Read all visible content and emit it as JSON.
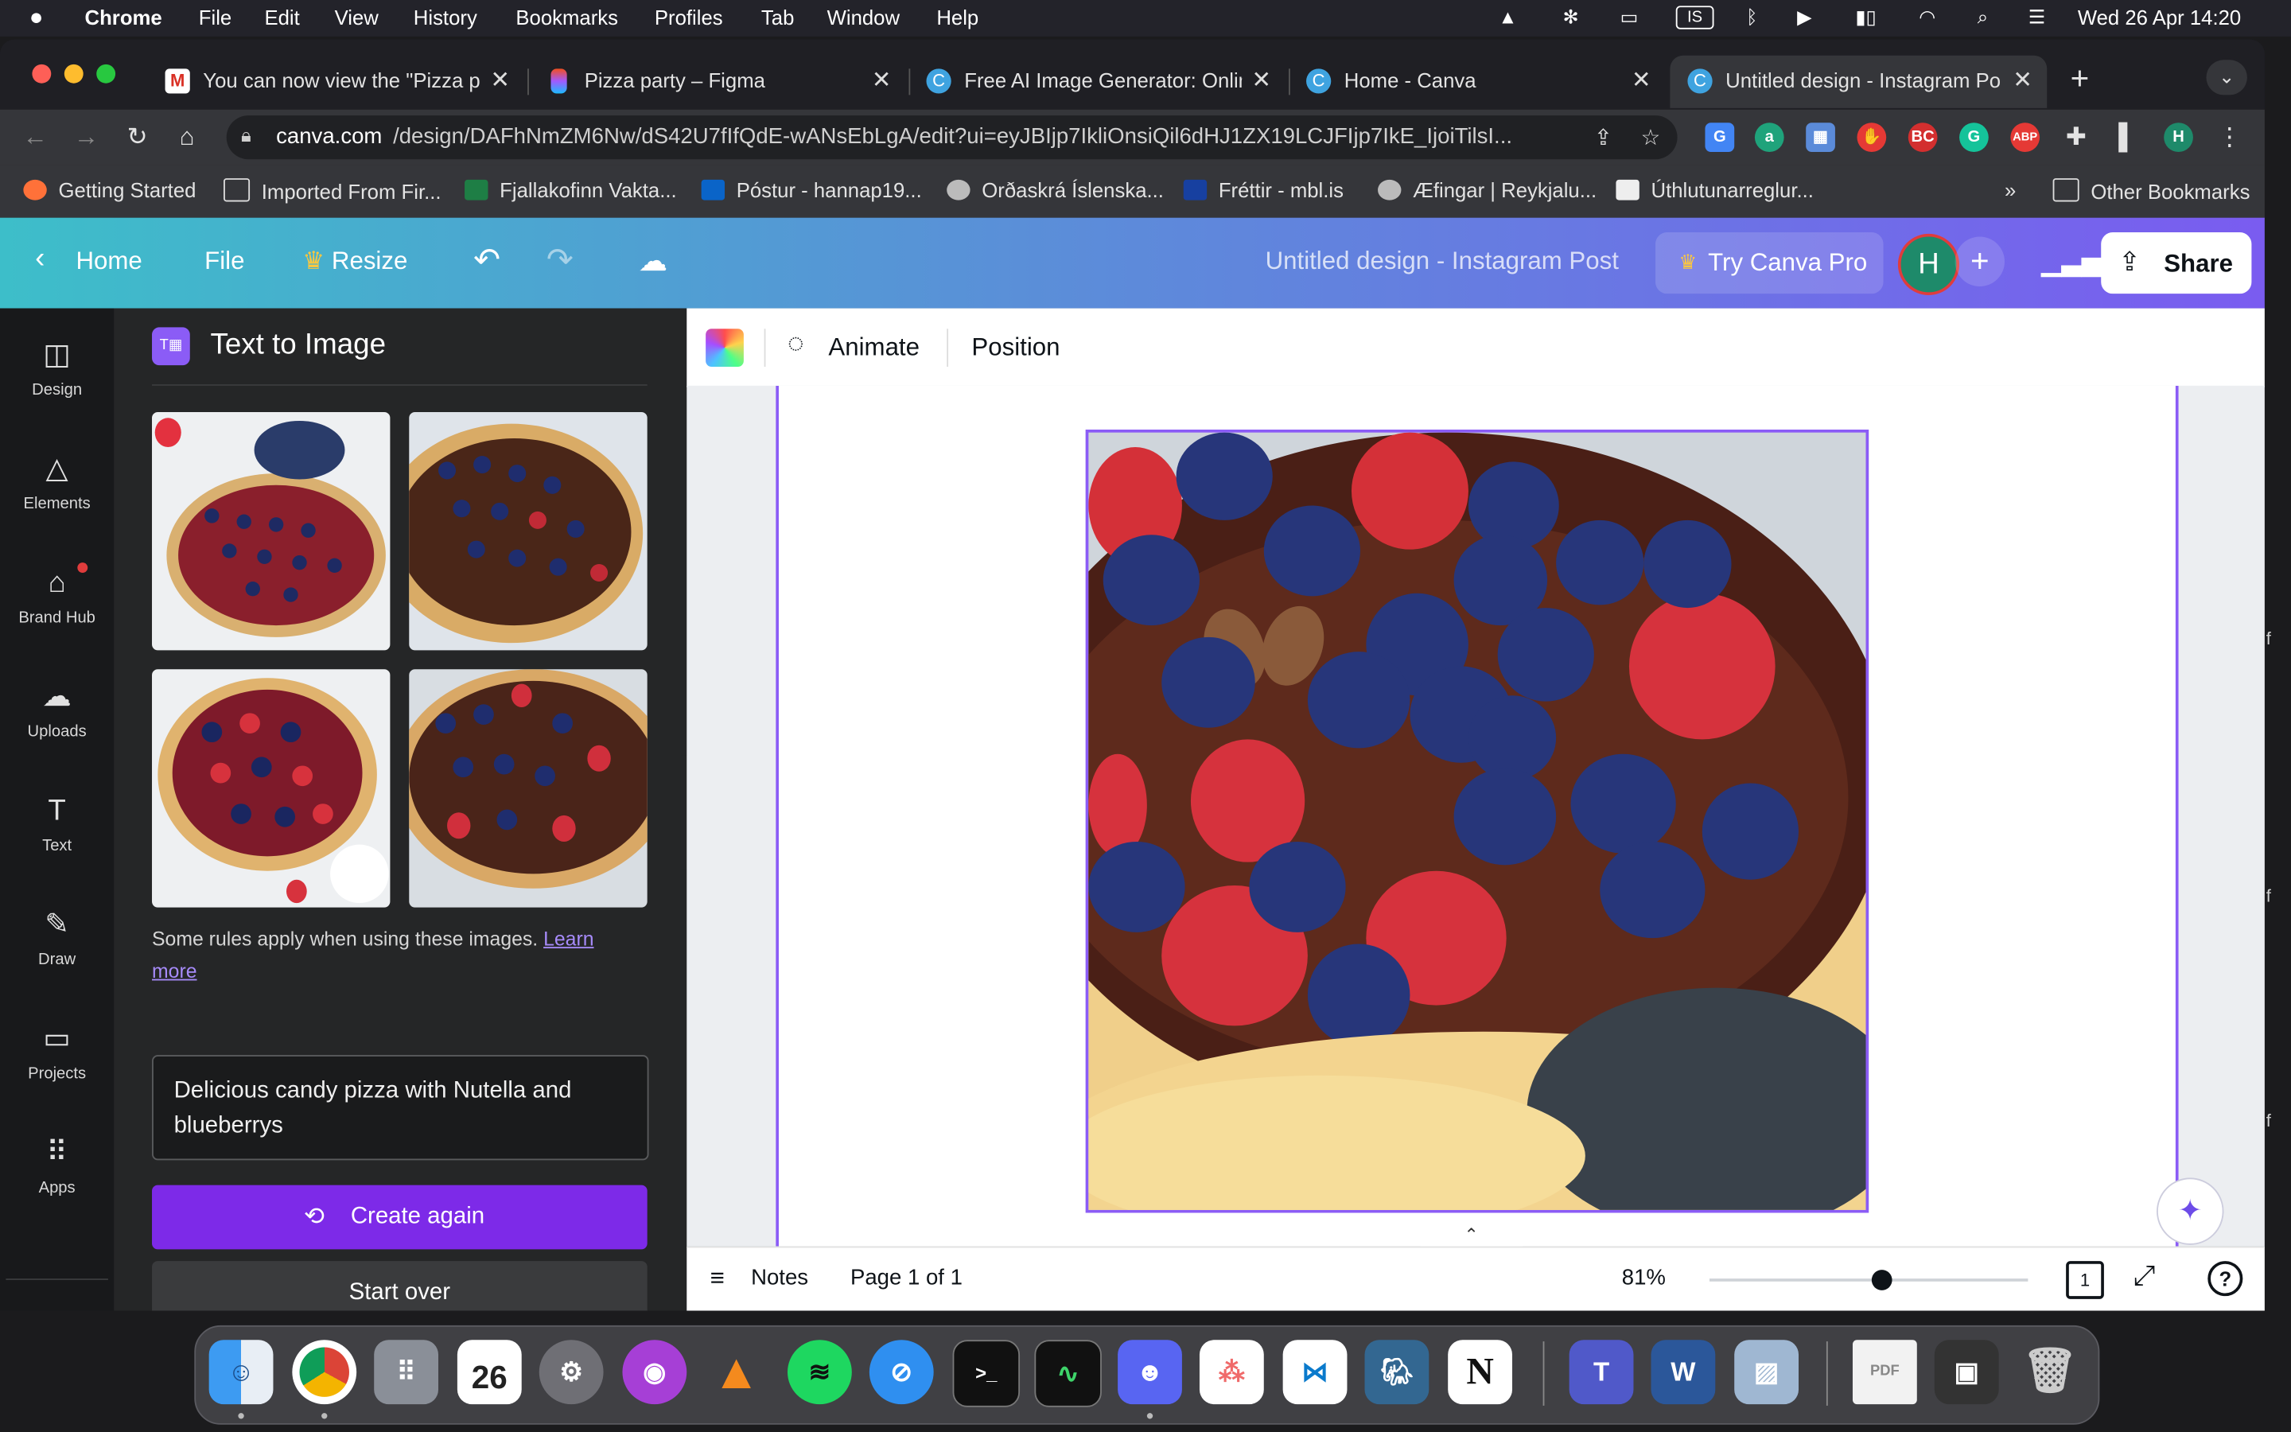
{
  "menubar": {
    "app": "Chrome",
    "items": [
      "File",
      "Edit",
      "View",
      "History",
      "Bookmarks",
      "Profiles",
      "Tab",
      "Window",
      "Help"
    ],
    "keyboard": "IS",
    "datetime": "Wed 26 Apr  14:20"
  },
  "tabs": [
    {
      "title": "You can now view the \"Pizza p",
      "icon": "gmail-icon",
      "close": "✕"
    },
    {
      "title": "Pizza party – Figma",
      "icon": "figma-icon",
      "close": "✕"
    },
    {
      "title": "Free AI Image Generator: Onlin",
      "icon": "canva-icon",
      "close": "✕"
    },
    {
      "title": "Home - Canva",
      "icon": "canva-icon",
      "close": "✕"
    },
    {
      "title": "Untitled design - Instagram Po",
      "icon": "canva-icon",
      "close": "✕"
    }
  ],
  "new_tab": "+",
  "address": {
    "domain": "canva.com",
    "path": "/design/DAFhNmZM6Nw/dS42U7fIfQdE-wANsEbLgA/edit?ui=eyJBIjp7IkliOnsiQil6dHJ1ZX19LCJFIjp7IkE_IjoiTilsI..."
  },
  "bookmarks": [
    "Getting Started",
    "Imported From Fir...",
    "Fjallakofinn Vakta...",
    "Póstur - hannap19...",
    "Orðaskrá Íslenska...",
    "Fréttir - mbl.is",
    "Æfingar | Reykjalu...",
    "Úthlutunarreglur..."
  ],
  "bookmarks_more": "»",
  "other_bookmarks": "Other Bookmarks",
  "canva": {
    "home": "Home",
    "file": "File",
    "resize": "Resize",
    "title": "Untitled design - Instagram Post",
    "try_pro": "Try Canva Pro",
    "avatar": "H",
    "share": "Share",
    "add": "+"
  },
  "rail": [
    "Design",
    "Elements",
    "Brand Hub",
    "Uploads",
    "Text",
    "Draw",
    "Projects",
    "Apps"
  ],
  "panel": {
    "title": "Text to Image",
    "rules_text": "Some rules apply when using these images. ",
    "learn_more": "Learn more",
    "prompt": "Delicious candy pizza with Nutella and blueberrys",
    "create_again": "Create again",
    "start_over": "Start over"
  },
  "canvas_toolbar": {
    "animate": "Animate",
    "position": "Position"
  },
  "footer": {
    "notes": "Notes",
    "page": "Page 1 of 1",
    "zoom": "81%",
    "zoom_level": 0.54,
    "page_count": "1",
    "help": "?"
  },
  "colors": {
    "accent": "#8b5cf6",
    "header_start": "#3dbec9",
    "header_end": "#7a5cf0",
    "button": "#7d2ae8"
  }
}
